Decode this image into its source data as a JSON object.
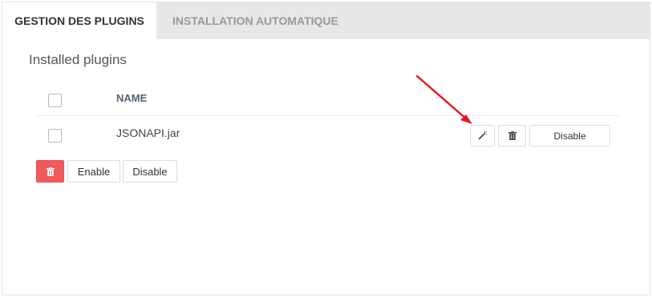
{
  "tabs": [
    {
      "label": "GESTION DES PLUGINS",
      "active": true
    },
    {
      "label": "INSTALLATION AUTOMATIQUE",
      "active": false
    }
  ],
  "section": {
    "title": "Installed plugins"
  },
  "table": {
    "columns": [
      "NAME"
    ],
    "rows": [
      {
        "name": "JSONAPI.jar",
        "disable_label": "Disable"
      }
    ]
  },
  "bulk_actions": {
    "enable_label": "Enable",
    "disable_label": "Disable"
  },
  "icons": {
    "edit": "magic-wand-icon",
    "delete": "trash-icon",
    "annotation": "red-arrow"
  },
  "colors": {
    "danger": "#f05a5a",
    "arrow": "#e8161b",
    "tabbar": "#e7e7e7"
  }
}
